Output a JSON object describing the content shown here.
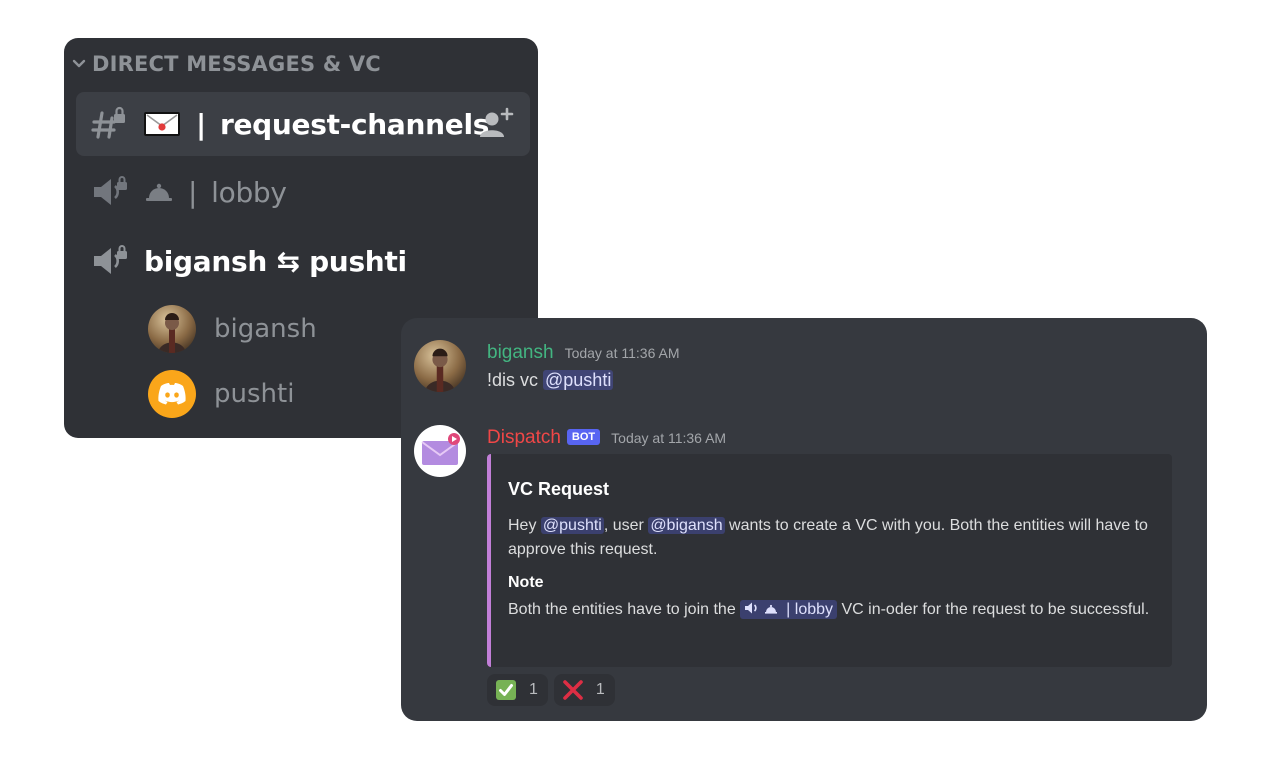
{
  "sidebar": {
    "category": "DIRECT MESSAGES & VC",
    "channels": [
      {
        "separator": "|",
        "name": "request-channels",
        "active": true,
        "icon": "hashtag-lock-icon",
        "emoji": "envelope-emoji"
      },
      {
        "separator": "|",
        "name": "lobby",
        "icon": "speaker-lock-icon",
        "emoji": "bellhop-bell-emoji"
      },
      {
        "name": "bigansh ⇆ pushti",
        "icon": "speaker-lock-icon"
      }
    ],
    "voice_users": [
      {
        "name": "bigansh",
        "avatar": "photo-avatar"
      },
      {
        "name": "pushti",
        "avatar": "discord-logo-avatar"
      }
    ]
  },
  "chat": {
    "messages": [
      {
        "author": "bigansh",
        "author_color": "#43b581",
        "timestamp": "Today at 11:36 AM",
        "text_prefix": "!dis vc ",
        "mention": "@pushti"
      },
      {
        "author": "Dispatch",
        "author_color": "#f04747",
        "bot_tag": "BOT",
        "timestamp": "Today at 11:36 AM",
        "embed": {
          "title": "VC Request",
          "desc_1": "Hey ",
          "mention_1": "@pushti",
          "desc_2": ", user ",
          "mention_2": "@bigansh",
          "desc_3": " wants to create a VC with you. Both the entities will have to approve this request.",
          "note_title": "Note",
          "note_1": "Both the entities have to join the ",
          "channel_mention_sep": "|",
          "channel_mention_name": "lobby",
          "note_2": " VC in-oder for the request to be successful.",
          "accent": "#c27fd8"
        }
      }
    ],
    "reactions": [
      {
        "emoji": "check-mark-icon",
        "count": "1"
      },
      {
        "emoji": "cross-mark-icon",
        "count": "1"
      }
    ]
  },
  "colors": {
    "sidebar_bg": "#2f3136",
    "chat_bg": "#36393f",
    "mention_bg": "#5865f2"
  }
}
